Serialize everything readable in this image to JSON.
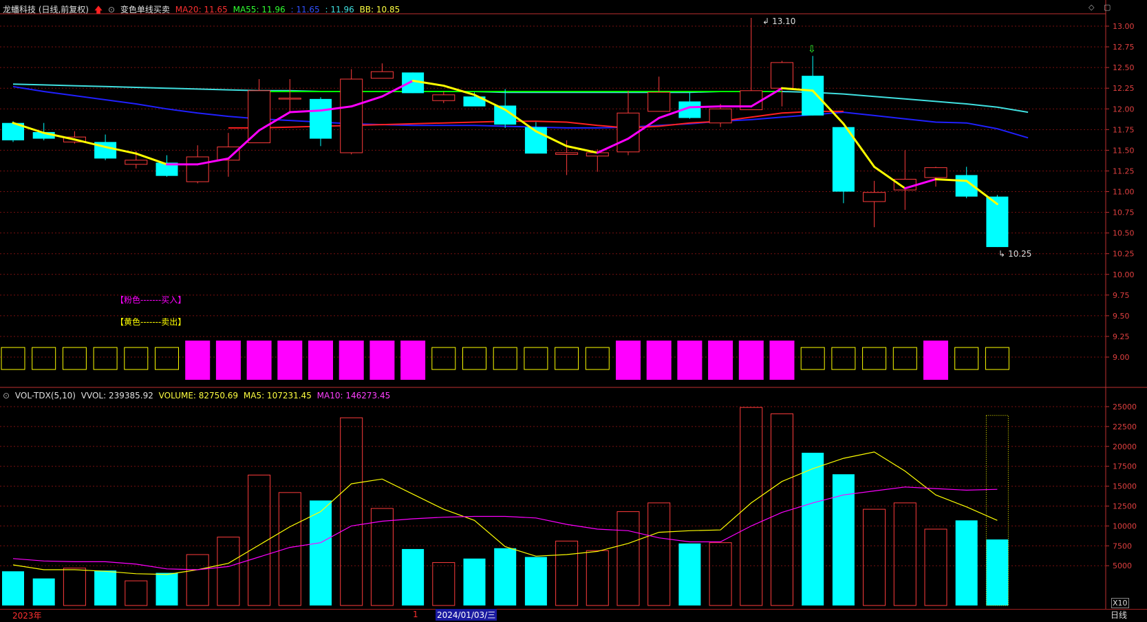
{
  "header": {
    "title": "龙蟠科技 (日线,前复权)",
    "indicator_name": "变色单线买卖",
    "ma20_label": "MA20: 11.65",
    "ma55_label": "MA55: 11.96",
    "blue_label": ": 11.65",
    "cyan_label": ": 11.96",
    "bb_label": "BB: 10.85"
  },
  "vol_header": {
    "title": "VOL-TDX(5,10)",
    "vvol": "VVOL: 239385.92",
    "volume": "VOLUME: 82750.69",
    "ma5": "MA5: 107231.45",
    "ma10": "MA10: 146273.45"
  },
  "legend": {
    "buy": "【粉色-------买入】",
    "sell": "【黄色-------卖出】"
  },
  "annotations": {
    "high": "13.10",
    "low": "10.25"
  },
  "bottom_bar": {
    "year": "2023年",
    "sep": "1",
    "date": "2024/01/03/三",
    "period": "日线",
    "x10": "X10"
  },
  "colors": {
    "up": "#ff3c3c",
    "down": "#00ffff",
    "ma20": "#ff2020",
    "ma55": "#00ff00",
    "blue": "#2020ff",
    "cyan": "#40e0e0",
    "buy": "#ff00ff",
    "sell": "#ffff00",
    "grid": "#7a1010",
    "axis": "#c03030"
  },
  "chart_data": [
    {
      "type": "candlestick",
      "ylim": [
        8.75,
        13.25
      ],
      "yticks": [
        9.0,
        9.25,
        9.5,
        9.75,
        10.0,
        10.25,
        10.5,
        10.75,
        11.0,
        11.25,
        11.5,
        11.75,
        12.0,
        12.25,
        12.5,
        12.75,
        13.0
      ],
      "candles": [
        {
          "o": 11.83,
          "h": 11.85,
          "l": 11.6,
          "c": 11.62
        },
        {
          "o": 11.72,
          "h": 11.83,
          "l": 11.62,
          "c": 11.64
        },
        {
          "o": 11.6,
          "h": 11.73,
          "l": 11.58,
          "c": 11.66
        },
        {
          "o": 11.6,
          "h": 11.69,
          "l": 11.38,
          "c": 11.4
        },
        {
          "o": 11.33,
          "h": 11.49,
          "l": 11.28,
          "c": 11.38
        },
        {
          "o": 11.35,
          "h": 11.44,
          "l": 11.18,
          "c": 11.19
        },
        {
          "o": 11.12,
          "h": 11.56,
          "l": 11.1,
          "c": 11.42
        },
        {
          "o": 11.38,
          "h": 11.71,
          "l": 11.18,
          "c": 11.54
        },
        {
          "o": 11.59,
          "h": 12.36,
          "l": 11.59,
          "c": 12.22
        },
        {
          "o": 12.12,
          "h": 12.36,
          "l": 11.97,
          "c": 12.13
        },
        {
          "o": 12.12,
          "h": 12.14,
          "l": 11.55,
          "c": 11.64
        },
        {
          "o": 11.47,
          "h": 12.48,
          "l": 11.45,
          "c": 12.36
        },
        {
          "o": 12.37,
          "h": 12.55,
          "l": 12.37,
          "c": 12.45
        },
        {
          "o": 12.44,
          "h": 12.44,
          "l": 12.19,
          "c": 12.19
        },
        {
          "o": 12.1,
          "h": 12.21,
          "l": 12.07,
          "c": 12.17
        },
        {
          "o": 12.15,
          "h": 12.2,
          "l": 12.04,
          "c": 12.03
        },
        {
          "o": 12.04,
          "h": 12.24,
          "l": 11.77,
          "c": 11.81
        },
        {
          "o": 11.78,
          "h": 11.84,
          "l": 11.46,
          "c": 11.46
        },
        {
          "o": 11.45,
          "h": 11.62,
          "l": 11.2,
          "c": 11.47
        },
        {
          "o": 11.43,
          "h": 11.51,
          "l": 11.24,
          "c": 11.47
        },
        {
          "o": 11.48,
          "h": 12.22,
          "l": 11.44,
          "c": 11.95
        },
        {
          "o": 11.97,
          "h": 12.39,
          "l": 11.97,
          "c": 12.2
        },
        {
          "o": 12.09,
          "h": 12.2,
          "l": 11.88,
          "c": 11.89
        },
        {
          "o": 11.83,
          "h": 12.06,
          "l": 11.78,
          "c": 12.0
        },
        {
          "o": 11.99,
          "h": 13.1,
          "l": 11.99,
          "c": 12.22
        },
        {
          "o": 12.25,
          "h": 12.58,
          "l": 12.03,
          "c": 12.56
        },
        {
          "o": 12.4,
          "h": 12.64,
          "l": 11.92,
          "c": 11.92
        },
        {
          "o": 11.78,
          "h": 11.78,
          "l": 10.86,
          "c": 11.0
        },
        {
          "o": 10.88,
          "h": 11.13,
          "l": 10.57,
          "c": 10.99
        },
        {
          "o": 11.02,
          "h": 11.5,
          "l": 10.78,
          "c": 11.15
        },
        {
          "o": 11.17,
          "h": 11.3,
          "l": 11.06,
          "c": 11.29
        },
        {
          "o": 11.2,
          "h": 11.3,
          "l": 10.92,
          "c": 10.94
        },
        {
          "o": 10.94,
          "h": 10.96,
          "l": 10.33,
          "c": 10.33
        }
      ],
      "bb_line": [
        11.83,
        11.71,
        11.63,
        11.54,
        11.46,
        11.33,
        11.33,
        11.4,
        11.74,
        11.96,
        11.98,
        12.03,
        12.15,
        12.34,
        12.28,
        12.17,
        11.99,
        11.73,
        11.55,
        11.47,
        11.64,
        11.89,
        12.02,
        12.03,
        12.03,
        12.25,
        12.22,
        11.82,
        11.3,
        11.04,
        11.15,
        11.13,
        10.85
      ],
      "signal": [
        "sell",
        "sell",
        "sell",
        "sell",
        "sell",
        "sell",
        "buy",
        "buy",
        "buy",
        "buy",
        "buy",
        "buy",
        "buy",
        "buy",
        "sell",
        "sell",
        "sell",
        "sell",
        "sell",
        "sell",
        "buy",
        "buy",
        "buy",
        "buy",
        "buy",
        "buy",
        "sell",
        "sell",
        "sell",
        "sell",
        "buy",
        "sell",
        "sell"
      ],
      "ma20": {
        "start": 7,
        "end": 27,
        "values": [
          11.77,
          11.77,
          11.78,
          11.79,
          11.8,
          11.81,
          11.82,
          11.83,
          11.84,
          11.85,
          11.85,
          11.84,
          11.8,
          11.77,
          11.79,
          11.83,
          11.85,
          11.9,
          11.95,
          11.97,
          11.97
        ]
      },
      "ma55": {
        "start": 8,
        "end": 25,
        "values": [
          12.21,
          12.21,
          12.21,
          12.21,
          12.21,
          12.21,
          12.21,
          12.21,
          12.21,
          12.21,
          12.21,
          12.21,
          12.21,
          12.21,
          12.21,
          12.21,
          12.21,
          12.21
        ]
      },
      "blue_ma": [
        12.27,
        12.21,
        12.16,
        12.11,
        12.06,
        12.0,
        11.95,
        11.91,
        11.88,
        11.86,
        11.84,
        11.82,
        11.81,
        11.8,
        11.8,
        11.8,
        11.79,
        11.78,
        11.77,
        11.77,
        11.78,
        11.8,
        11.82,
        11.85,
        11.87,
        11.9,
        11.93,
        11.96,
        11.92,
        11.88,
        11.84,
        11.83,
        11.76,
        11.65
      ],
      "cyan_ma": [
        12.3,
        12.29,
        12.28,
        12.27,
        12.26,
        12.25,
        12.24,
        12.23,
        12.22,
        12.22,
        12.21,
        12.21,
        12.21,
        12.21,
        12.21,
        12.21,
        12.2,
        12.2,
        12.2,
        12.2,
        12.2,
        12.2,
        12.2,
        12.21,
        12.21,
        12.21,
        12.2,
        12.18,
        12.15,
        12.12,
        12.09,
        12.06,
        12.02,
        11.96
      ]
    },
    {
      "type": "bar",
      "ylim": [
        0,
        26000
      ],
      "yticks": [
        5000,
        7500,
        10000,
        12500,
        15000,
        17500,
        20000,
        22500,
        25000
      ],
      "volumes": [
        4300,
        3400,
        4700,
        4400,
        3100,
        4100,
        6400,
        8600,
        16400,
        14200,
        13200,
        23600,
        12200,
        7100,
        5400,
        5900,
        7200,
        6100,
        8100,
        6900,
        11800,
        12900,
        7800,
        7900,
        24900,
        24100,
        19200,
        16500,
        12100,
        12900,
        9600,
        10700,
        8300
      ],
      "last_total": 23900,
      "ma5": [
        5100,
        4500,
        4500,
        4300,
        4000,
        3900,
        4500,
        5300,
        7600,
        9900,
        11800,
        15300,
        15900,
        14000,
        12100,
        10700,
        7400,
        6200,
        6400,
        6800,
        7800,
        9200,
        9400,
        9500,
        12900,
        15600,
        17200,
        18500,
        19300,
        16900,
        13900,
        12400,
        10700
      ],
      "ma10": [
        5900,
        5600,
        5500,
        5500,
        5200,
        4600,
        4500,
        4900,
        6100,
        7300,
        7900,
        10000,
        10600,
        10900,
        11100,
        11200,
        11200,
        11000,
        10200,
        9600,
        9400,
        8500,
        8000,
        8000,
        10000,
        11700,
        12900,
        13900,
        14400,
        14900,
        14700,
        14500,
        14600
      ]
    }
  ]
}
